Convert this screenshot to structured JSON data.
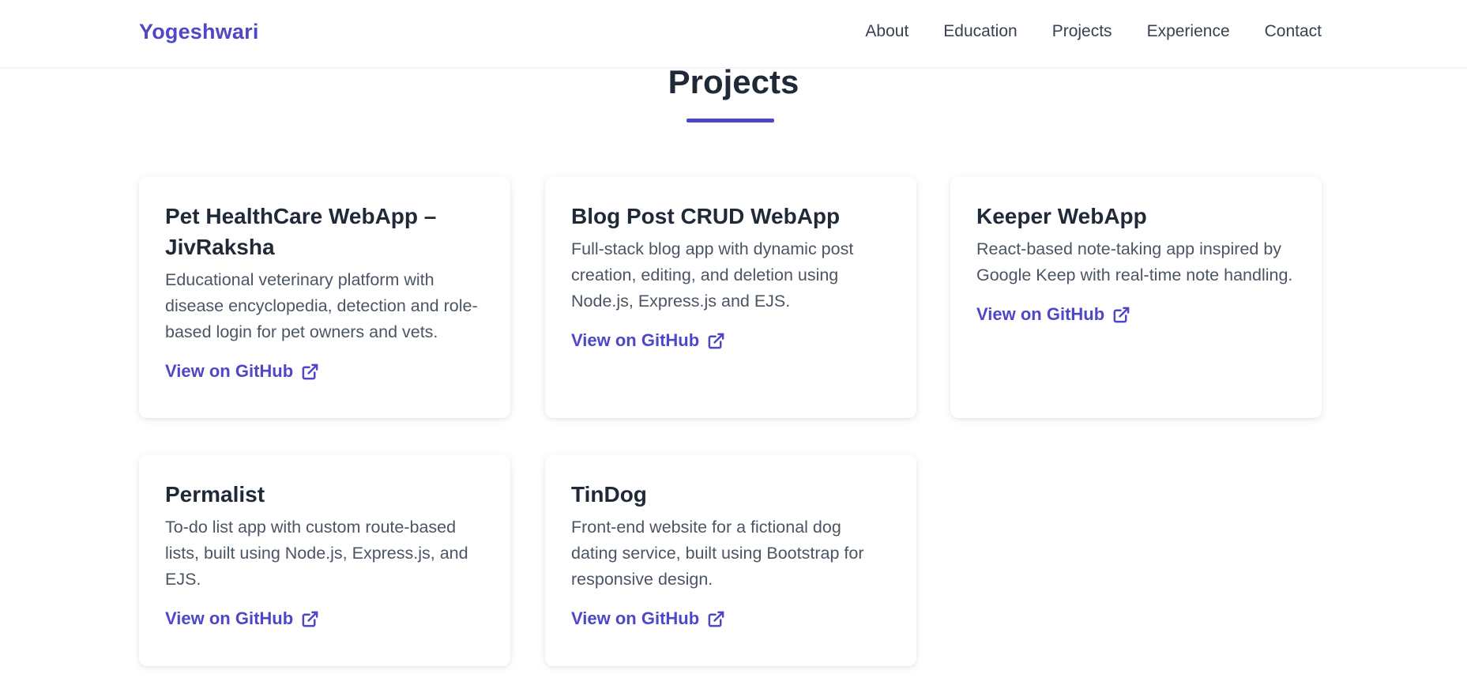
{
  "header": {
    "brand": "Yogeshwari",
    "nav": [
      {
        "label": "About"
      },
      {
        "label": "Education"
      },
      {
        "label": "Projects"
      },
      {
        "label": "Experience"
      },
      {
        "label": "Contact"
      }
    ]
  },
  "section": {
    "title": "Projects"
  },
  "projects": [
    {
      "title": "Pet HealthCare WebApp – JivRaksha",
      "description": "Educational veterinary platform with disease encyclopedia, detection and role-based login for pet owners and vets.",
      "link_label": "View on GitHub",
      "link_icon": "external-link-icon"
    },
    {
      "title": "Blog Post CRUD WebApp",
      "description": "Full-stack blog app with dynamic post creation, editing, and deletion using Node.js, Express.js and EJS.",
      "link_label": "View on GitHub",
      "link_icon": "external-link-icon"
    },
    {
      "title": "Keeper WebApp",
      "description": "React-based note-taking app inspired by Google Keep with real-time note handling.",
      "link_label": "View on GitHub",
      "link_icon": "external-link-icon"
    },
    {
      "title": "Permalist",
      "description": "To-do list app with custom route-based lists, built using Node.js, Express.js, and EJS.",
      "link_label": "View on GitHub",
      "link_icon": "external-link-icon"
    },
    {
      "title": "TinDog",
      "description": "Front-end website for a fictional dog dating service, built using Bootstrap for responsive design.",
      "link_label": "View on GitHub",
      "link_icon": "external-link-icon"
    }
  ],
  "colors": {
    "accent": "#4f46c8",
    "heading": "#1f2937",
    "body_text": "#4b5563",
    "background": "#ffffff"
  }
}
